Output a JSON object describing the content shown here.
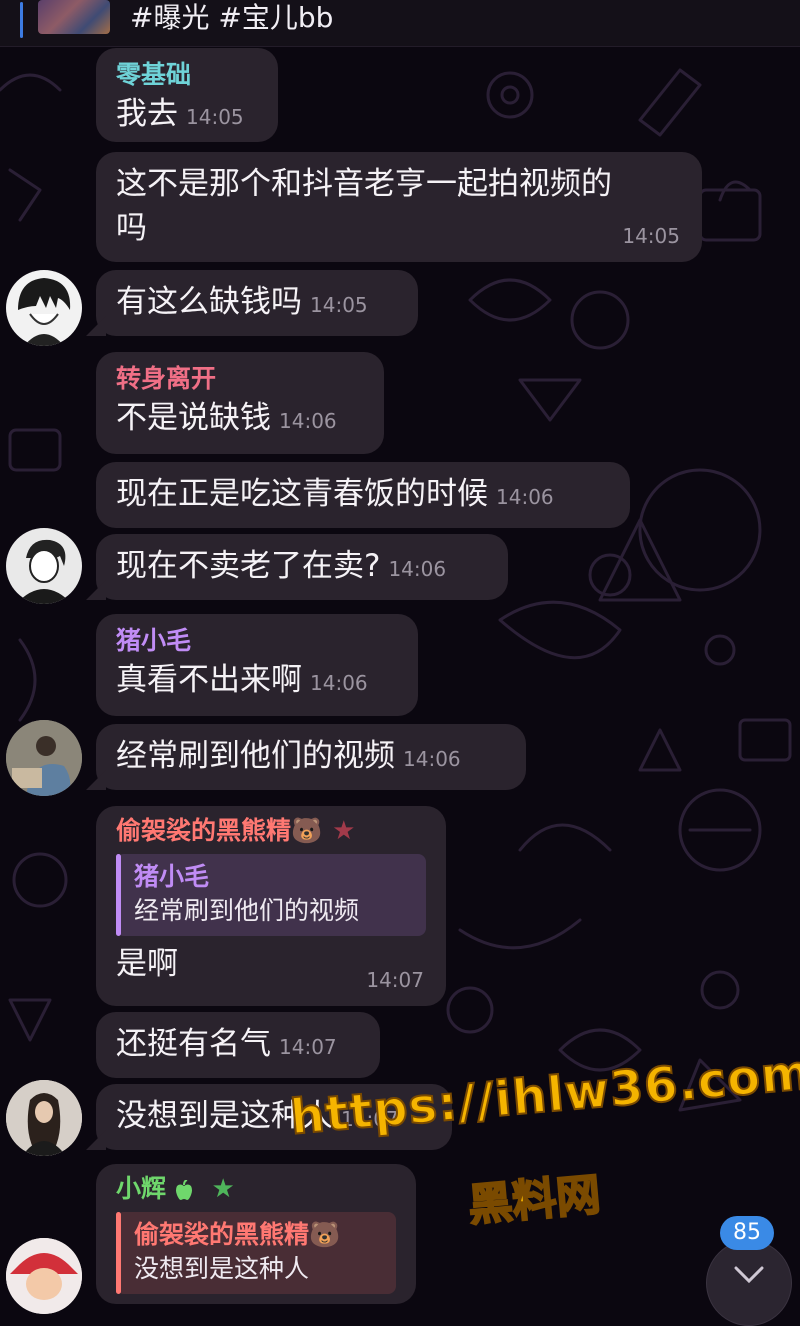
{
  "header": {
    "title": "#曝光 #宝儿bb"
  },
  "colors": {
    "bubble": "#2a232d",
    "name_teal": "#6fd3d8",
    "name_pink": "#f06f86",
    "name_purple": "#c08cf5",
    "name_red": "#ff7872",
    "name_green": "#6fd76c",
    "unread_badge": "#3a8ae6"
  },
  "messages": [
    {
      "sender": "零基础",
      "text": "我去",
      "time": "14:05"
    },
    {
      "text_line1": "这不是那个和抖音老亨一起拍视频的",
      "text_line2": "吗",
      "time": "14:05"
    },
    {
      "text": "有这么缺钱吗",
      "time": "14:05"
    },
    {
      "sender": "转身离开",
      "text": "不是说缺钱",
      "time": "14:06"
    },
    {
      "text": "现在正是吃这青春饭的时候",
      "time": "14:06"
    },
    {
      "text": "现在不卖老了在卖?",
      "time": "14:06"
    },
    {
      "sender": "猪小毛",
      "text": "真看不出来啊",
      "time": "14:06"
    },
    {
      "text": "经常刷到他们的视频",
      "time": "14:06"
    },
    {
      "sender": "偷袈裟的黑熊精🐻",
      "reply_name": "猪小毛",
      "reply_text": "经常刷到他们的视频",
      "text": "是啊",
      "time": "14:07"
    },
    {
      "text": "还挺有名气",
      "time": "14:07"
    },
    {
      "text": "没想到是这种人",
      "time": "14:07"
    },
    {
      "sender": "小辉",
      "reply_name": "偷袈裟的黑熊精🐻",
      "reply_text": "没想到是这种人"
    }
  ],
  "watermark": {
    "url": "https://ihlw36.com",
    "name": "黑料网"
  },
  "unread_count": "85"
}
